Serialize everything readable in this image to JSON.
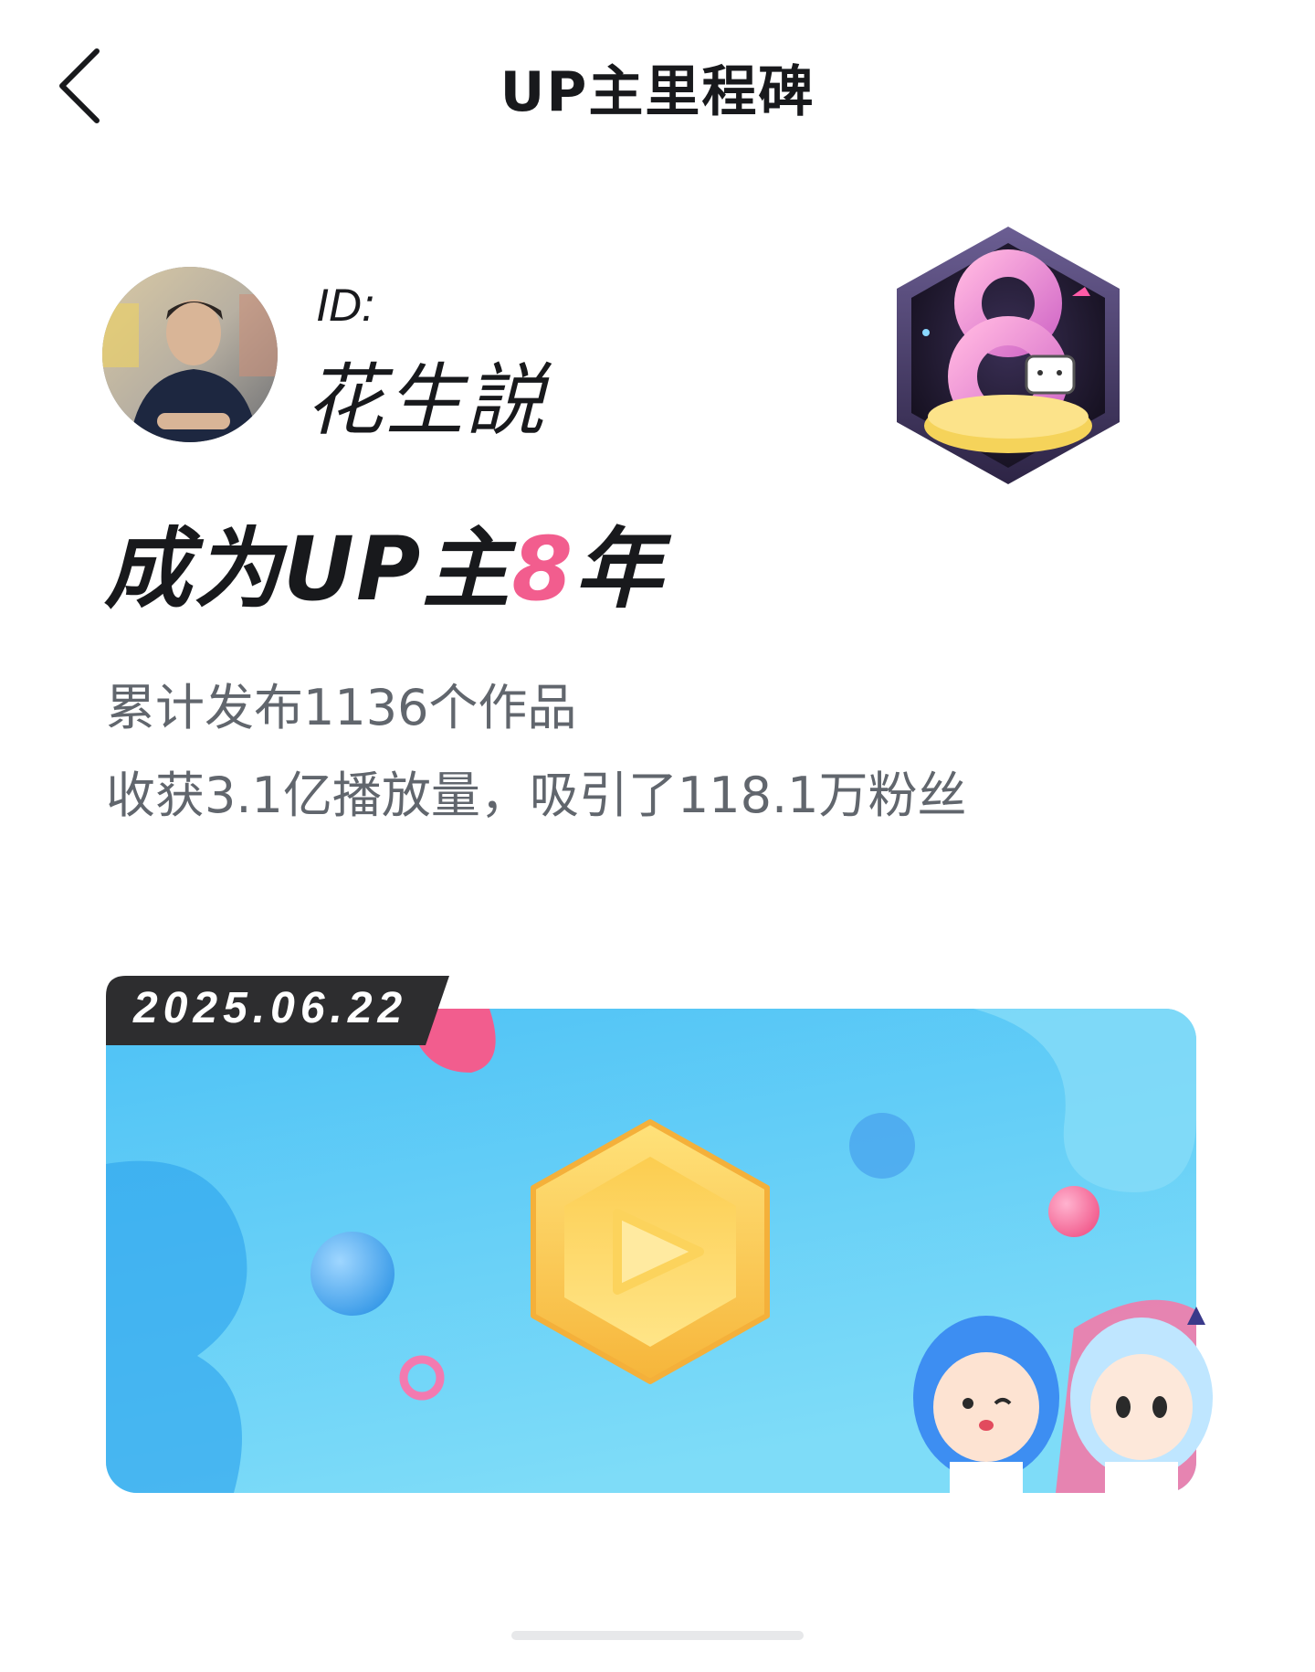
{
  "nav": {
    "title": "UP主里程碑",
    "back_icon": "chevron-left-icon"
  },
  "profile": {
    "id_label": "ID:",
    "name": "花生説",
    "badge_icon": "anniversary-8-badge-icon"
  },
  "headline": {
    "prefix": "成为UP主",
    "number": "8",
    "suffix": "年",
    "accent_color": "#f25d8e"
  },
  "stats": {
    "line1": "累计发布1136个作品",
    "line2": "收获3.1亿播放量，吸引了118.1万粉丝"
  },
  "milestone": {
    "date": "2025.06.22",
    "icon": "play-hexagon-icon"
  },
  "colors": {
    "accent": "#f25d8e",
    "banner_blue": "#4cc3f5",
    "text_primary": "#18191c",
    "text_secondary": "#61666d"
  }
}
